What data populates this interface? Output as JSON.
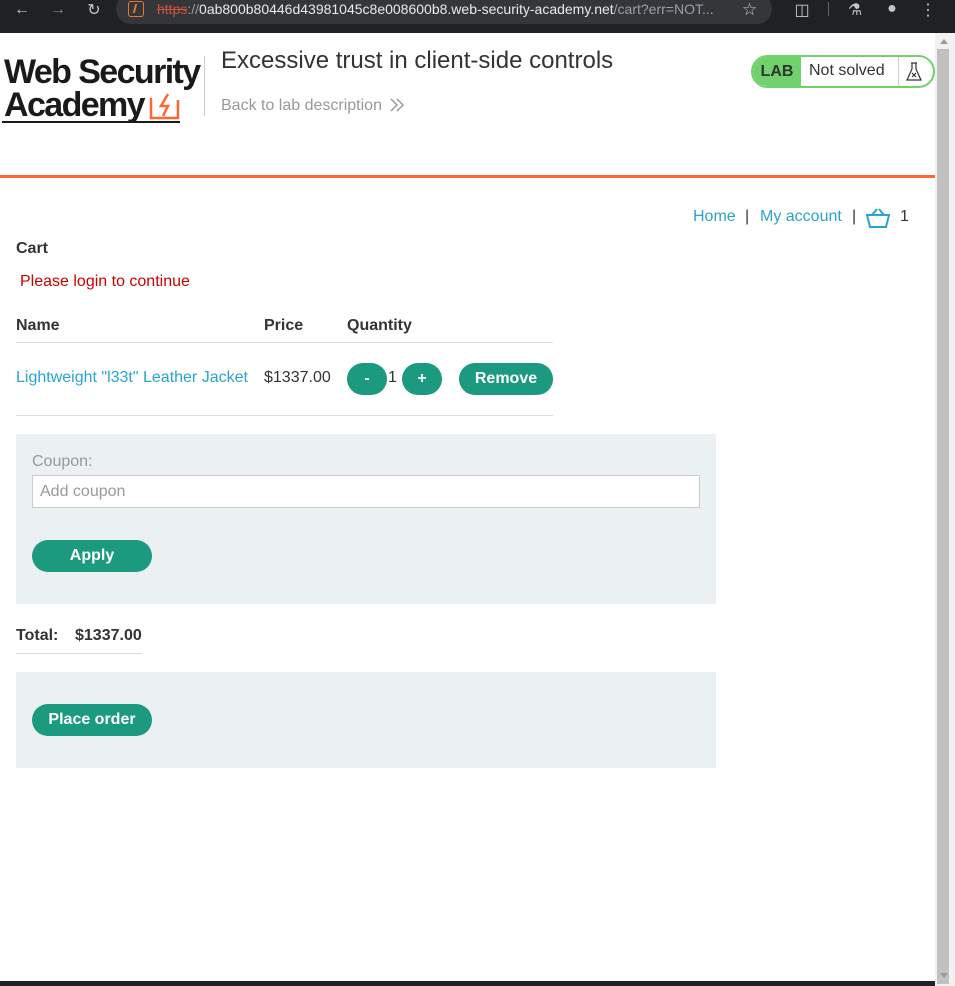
{
  "browser": {
    "url_scheme": "https",
    "url_sep": "://",
    "url_host": "0ab800b80446d43981045c8e008600b8.web-security-academy.net",
    "url_path": "/cart?err=NOT..."
  },
  "header": {
    "logo_line1": "Web Security",
    "logo_line2": "Academy",
    "lab_title": "Excessive trust in client-side controls",
    "back_link": "Back to lab description",
    "lab_tag": "LAB",
    "lab_status": "Not solved"
  },
  "colors": {
    "accent_orange": "#ff6633",
    "button_teal": "#1b9a7f",
    "link_blue": "#29a3cf",
    "lab_green": "#70d16d",
    "error_red": "#cc0000"
  },
  "nav": {
    "home": "Home",
    "sep1": "|",
    "my_account": "My account",
    "sep2": "|",
    "cart_count": "1"
  },
  "cart": {
    "title": "Cart",
    "error": "Please login to continue",
    "columns": [
      "Name",
      "Price",
      "Quantity"
    ],
    "items": [
      {
        "name": "Lightweight \"l33t\" Leather Jacket",
        "price": "$1337.00",
        "quantity": "1",
        "minus": "-",
        "plus": "+",
        "remove": "Remove"
      }
    ]
  },
  "coupon": {
    "label": "Coupon:",
    "placeholder": "Add coupon",
    "apply": "Apply"
  },
  "total": {
    "label": "Total:",
    "value": "$1337.00"
  },
  "order": {
    "place_order": "Place order"
  }
}
